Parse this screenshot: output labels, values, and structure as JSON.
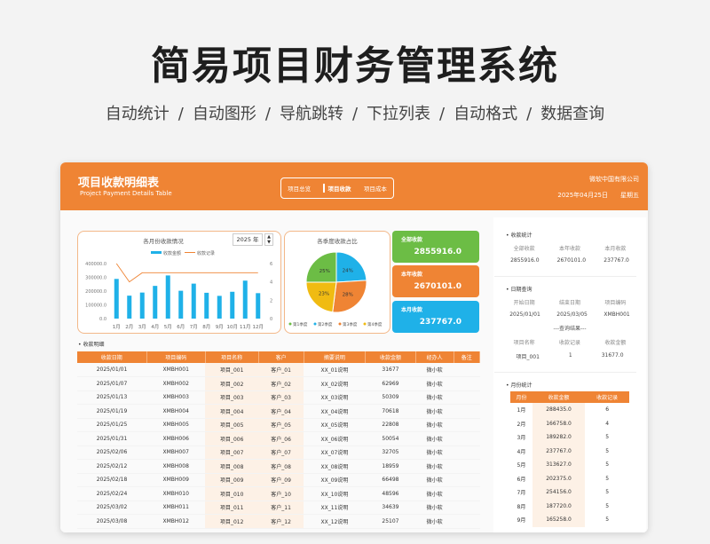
{
  "hero": {
    "title": "简易项目财务管理系统",
    "features": [
      "自动统计",
      "自动图形",
      "导航跳转",
      "下拉列表",
      "自动格式",
      "数据查询"
    ]
  },
  "header": {
    "title": "项目收款明细表",
    "subtitle": "Project Payment Details Table",
    "nav": [
      "项目总览",
      "项目收款",
      "项目成本"
    ],
    "company": "微软中国有限公司",
    "date": "2025年04月25日",
    "weekday": "星期五"
  },
  "colors": {
    "accent": "#ef8434",
    "green": "#6cbd45",
    "orange": "#ef8434",
    "blue": "#1fb1e8",
    "yellow": "#f0bb12"
  },
  "monthly_chart": {
    "title": "各月份收款情况",
    "year": "2025 年",
    "legend": [
      "收款金额",
      "收款记录"
    ],
    "ytick_left": [
      "400000.0",
      "300000.0",
      "200000.0",
      "100000.0",
      "0.0"
    ],
    "ytick_right": [
      "6",
      "4",
      "2",
      "0"
    ]
  },
  "pie_chart": {
    "title": "各季度收款占比",
    "legend": [
      "第1季度",
      "第2季度",
      "第3季度",
      "第4季度"
    ]
  },
  "chart_data": [
    {
      "type": "bar",
      "title": "各月份收款情况",
      "categories": [
        "1月",
        "2月",
        "3月",
        "4月",
        "5月",
        "6月",
        "7月",
        "8月",
        "9月",
        "10月",
        "11月",
        "12月"
      ],
      "series": [
        {
          "name": "收款金额",
          "values": [
            288435,
            166758,
            189282,
            237767,
            313627,
            202375,
            254156,
            187720,
            165258,
            195000,
            276000,
            185000
          ]
        },
        {
          "name": "收款记录",
          "values": [
            6,
            4,
            5,
            5,
            5,
            5,
            5,
            5,
            5,
            5,
            5,
            5
          ]
        }
      ],
      "ylim": [
        0,
        400000
      ],
      "y2lim": [
        0,
        6
      ]
    },
    {
      "type": "pie",
      "title": "各季度收款占比",
      "categories": [
        "第1季度",
        "第2季度",
        "第3季度",
        "第4季度"
      ],
      "values": [
        25,
        24,
        28,
        23
      ]
    }
  ],
  "kpis": [
    {
      "label": "全部收款",
      "value": "2855916.0",
      "color": "#6cbd45"
    },
    {
      "label": "本年收款",
      "value": "2670101.0",
      "color": "#ef8434"
    },
    {
      "label": "本月收款",
      "value": "237767.0",
      "color": "#1fb1e8"
    }
  ],
  "detail": {
    "section": "收款明细",
    "columns": [
      "收款日期",
      "项目编码",
      "项目名称",
      "客户",
      "摘要说明",
      "收款金额",
      "经办人",
      "备注"
    ],
    "rows": [
      [
        "2025/01/01",
        "XMBH001",
        "项目_001",
        "客户_01",
        "XX_01说明",
        "31677",
        "微小软",
        ""
      ],
      [
        "2025/01/07",
        "XMBH002",
        "项目_002",
        "客户_02",
        "XX_02说明",
        "62969",
        "微小软",
        ""
      ],
      [
        "2025/01/13",
        "XMBH003",
        "项目_003",
        "客户_03",
        "XX_03说明",
        "50309",
        "微小软",
        ""
      ],
      [
        "2025/01/19",
        "XMBH004",
        "项目_004",
        "客户_04",
        "XX_04说明",
        "70618",
        "微小软",
        ""
      ],
      [
        "2025/01/25",
        "XMBH005",
        "项目_005",
        "客户_05",
        "XX_05说明",
        "22808",
        "微小软",
        ""
      ],
      [
        "2025/01/31",
        "XMBH006",
        "项目_006",
        "客户_06",
        "XX_06说明",
        "50054",
        "微小软",
        ""
      ],
      [
        "2025/02/06",
        "XMBH007",
        "项目_007",
        "客户_07",
        "XX_07说明",
        "32705",
        "微小软",
        ""
      ],
      [
        "2025/02/12",
        "XMBH008",
        "项目_008",
        "客户_08",
        "XX_08说明",
        "18959",
        "微小软",
        ""
      ],
      [
        "2025/02/18",
        "XMBH009",
        "项目_009",
        "客户_09",
        "XX_09说明",
        "66498",
        "微小软",
        ""
      ],
      [
        "2025/02/24",
        "XMBH010",
        "项目_010",
        "客户_10",
        "XX_10说明",
        "48596",
        "微小软",
        ""
      ],
      [
        "2025/03/02",
        "XMBH011",
        "项目_011",
        "客户_11",
        "XX_11说明",
        "34639",
        "微小软",
        ""
      ],
      [
        "2025/03/08",
        "XMBH012",
        "项目_012",
        "客户_12",
        "XX_12说明",
        "25107",
        "微小软",
        ""
      ]
    ]
  },
  "stats": {
    "section": "收款统计",
    "headers": [
      "全部收款",
      "本年收款",
      "本月收款"
    ],
    "values": [
      "2855916.0",
      "2670101.0",
      "237767.0"
    ]
  },
  "date_query": {
    "section": "日期查询",
    "headers": [
      "开始日期",
      "结束日期",
      "项目编码"
    ],
    "values": [
      "2025/01/01",
      "2025/03/05",
      "XMBH001"
    ],
    "result_label": "---查询结果---",
    "result_headers": [
      "项目名称",
      "收款记录",
      "收款金额"
    ],
    "result_values": [
      "项目_001",
      "1",
      "31677.0"
    ]
  },
  "monthly": {
    "section": "月份统计",
    "columns": [
      "月份",
      "收款金额",
      "收款记录"
    ],
    "rows": [
      [
        "1月",
        "288435.0",
        "6"
      ],
      [
        "2月",
        "166758.0",
        "4"
      ],
      [
        "3月",
        "189282.0",
        "5"
      ],
      [
        "4月",
        "237767.0",
        "5"
      ],
      [
        "5月",
        "313627.0",
        "5"
      ],
      [
        "6月",
        "202375.0",
        "5"
      ],
      [
        "7月",
        "254156.0",
        "5"
      ],
      [
        "8月",
        "187720.0",
        "5"
      ],
      [
        "9月",
        "165258.0",
        "5"
      ]
    ]
  }
}
